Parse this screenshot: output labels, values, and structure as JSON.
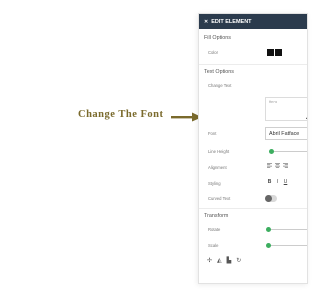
{
  "callout": {
    "text": "Change The Font"
  },
  "panel": {
    "header_icon": "edit-icon",
    "title": "EDIT ELEMENT",
    "fill_options": {
      "title": "Fill Options",
      "color_label": "Color",
      "swatches": [
        "#111111",
        "#111111"
      ]
    },
    "text_options": {
      "title": "Text Options",
      "change_text_label": "Change Text",
      "text_value": "Hero",
      "font_label": "Font",
      "font_value": "Abril Fatface",
      "line_height_label": "Line Height",
      "line_height_fraction": 0.05,
      "alignment_label": "Alignment",
      "alignment_icons": [
        "align-left-icon",
        "align-center-icon",
        "align-right-icon"
      ],
      "styling_label": "Styling",
      "bold": "B",
      "italic": "I",
      "underline": "U",
      "curved_text_label": "Curved Text",
      "curved_text_on": false
    },
    "transform": {
      "title": "Transform",
      "rotate_label": "Rotate",
      "rotate_fraction": 0.0,
      "scale_label": "Scale",
      "scale_fraction": 0.0
    },
    "tools": [
      "move-icon",
      "flip-icon",
      "layer-icon",
      "rotate-icon"
    ]
  }
}
